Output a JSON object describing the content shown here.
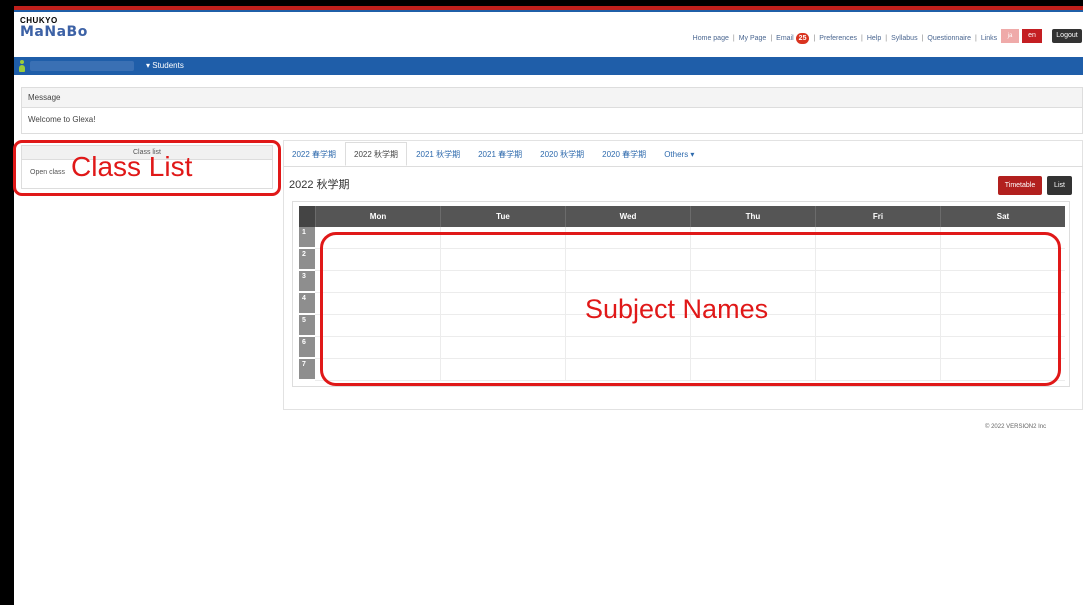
{
  "logo": {
    "top": "CHUKYO",
    "main": "MaNaBo"
  },
  "topnav": {
    "items": [
      "Home page",
      "My Page",
      "Email",
      "Preferences",
      "Help",
      "Syllabus",
      "Questionnaire",
      "Links"
    ],
    "email_badge": "25",
    "lang_jp": "ja",
    "lang_en": "en",
    "logout": "Logout"
  },
  "bluebar": {
    "menu": "▾ Students"
  },
  "message": {
    "header": "Message",
    "body": "Welcome to Glexa!"
  },
  "classlist": {
    "header": "Class list",
    "item": "Open class"
  },
  "tabs": [
    {
      "label": "2022 春学期"
    },
    {
      "label": "2022 秋学期"
    },
    {
      "label": "2021 秋学期"
    },
    {
      "label": "2021 春学期"
    },
    {
      "label": "2020 秋学期"
    },
    {
      "label": "2020 春学期"
    },
    {
      "label": "Others ▾"
    }
  ],
  "semester_title": "2022 秋学期",
  "view_buttons": {
    "timetable": "Timetable",
    "list": "List"
  },
  "timetable": {
    "days": [
      "Mon",
      "Tue",
      "Wed",
      "Thu",
      "Fri",
      "Sat"
    ],
    "periods": [
      "1",
      "2",
      "3",
      "4",
      "5",
      "6",
      "7"
    ]
  },
  "annotations": {
    "class_list": "Class List",
    "subject_names": "Subject Names"
  },
  "footer": "© 2022 VERSION2 Inc",
  "colors": {
    "accent_blue": "#1f5ea9",
    "brand_red": "#c41e22",
    "annotation_red": "#e01818"
  }
}
